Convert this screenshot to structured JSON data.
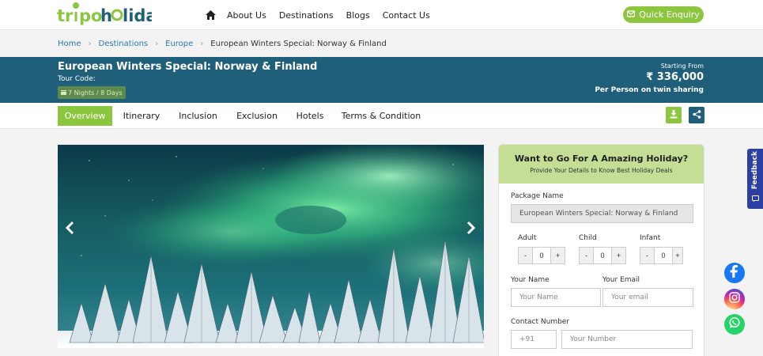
{
  "brand": {
    "logo_text": "tripoholidays"
  },
  "nav": {
    "items": [
      "About Us",
      "Destinations",
      "Blogs",
      "Contact Us"
    ],
    "enquiry_label": "Quick Enquiry"
  },
  "breadcrumb": [
    "Home",
    "Destinations",
    "Europe",
    "European Winters Special: Norway & Finland"
  ],
  "tour": {
    "title": "European Winters Special: Norway & Finland",
    "code_label": "Tour Code:",
    "duration": "7 Nights / 8 Days",
    "price_label": "Starting From",
    "price": "₹ 336,000",
    "price_note": "Per Person on twin sharing"
  },
  "tabs": [
    "Overview",
    "Itinerary",
    "Inclusion",
    "Exclusion",
    "Hotels",
    "Terms & Condition"
  ],
  "active_tab": "Overview",
  "form": {
    "title": "Want to Go For A Amazing Holiday?",
    "subtitle": "Provide Your Details to Know Best Holiday Deals",
    "package_label": "Package Name",
    "package_value": "European Winters Special: Norway & Finland",
    "adult_label": "Adult",
    "child_label": "Child",
    "infant_label": "Infant",
    "adult_count": "0",
    "child_count": "0",
    "infant_count": "0",
    "minus": "-",
    "plus": "+",
    "name_label": "Your Name",
    "name_placeholder": "Your Name",
    "email_label": "Your Email",
    "email_placeholder": "Your email",
    "contact_label": "Contact Number",
    "code_placeholder": "+91",
    "number_placeholder": "Your Number"
  },
  "feedback_label": "Feedback",
  "colors": {
    "brand_green": "#8cc63f",
    "brand_blue": "#1f5f7a",
    "form_header": "#c4df95",
    "feedback": "#2e3fa3"
  },
  "icons": [
    "home-icon",
    "envelope-icon",
    "calendar-icon",
    "download-icon",
    "share-icon",
    "chevron-left-icon",
    "chevron-right-icon",
    "feedback-icon",
    "facebook-icon",
    "instagram-icon",
    "whatsapp-icon"
  ]
}
